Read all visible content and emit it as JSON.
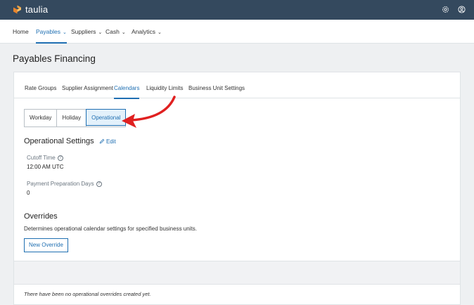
{
  "brand": {
    "name": "taulia",
    "logo_color": "#f2a341"
  },
  "topbar": {
    "icons": [
      "settings-icon",
      "user-icon"
    ]
  },
  "nav": {
    "items": [
      {
        "label": "Home"
      },
      {
        "label": "Payables"
      },
      {
        "label": "Suppliers"
      },
      {
        "label": "Cash"
      },
      {
        "label": "Analytics"
      }
    ],
    "chevron": "⌄",
    "active_index": 1
  },
  "page": {
    "title": "Payables Financing"
  },
  "tabs": [
    {
      "label": "Rate Groups"
    },
    {
      "label": "Supplier Assignment"
    },
    {
      "label": "Calendars"
    },
    {
      "label": "Liquidity Limits"
    },
    {
      "label": "Business Unit Settings"
    }
  ],
  "active_tab_index": 2,
  "calendar_types": [
    {
      "label": "Workday"
    },
    {
      "label": "Holiday"
    },
    {
      "label": "Operational"
    }
  ],
  "selected_calendar_type_index": 2,
  "operational_settings": {
    "title": "Operational Settings",
    "edit_label": "Edit",
    "cutoff_label": "Cutoff Time",
    "cutoff_value": "12:00 AM UTC",
    "prep_days_label": "Payment Preparation Days",
    "prep_days_value": "0"
  },
  "overrides": {
    "title": "Overrides",
    "description": "Determines operational calendar settings for specified business units.",
    "button_label": "New Override",
    "empty_message": "There have been no operational overrides created yet."
  },
  "colors": {
    "accent": "#1f6fb2",
    "topbar": "#34495e",
    "annotation_arrow": "#e02020"
  }
}
